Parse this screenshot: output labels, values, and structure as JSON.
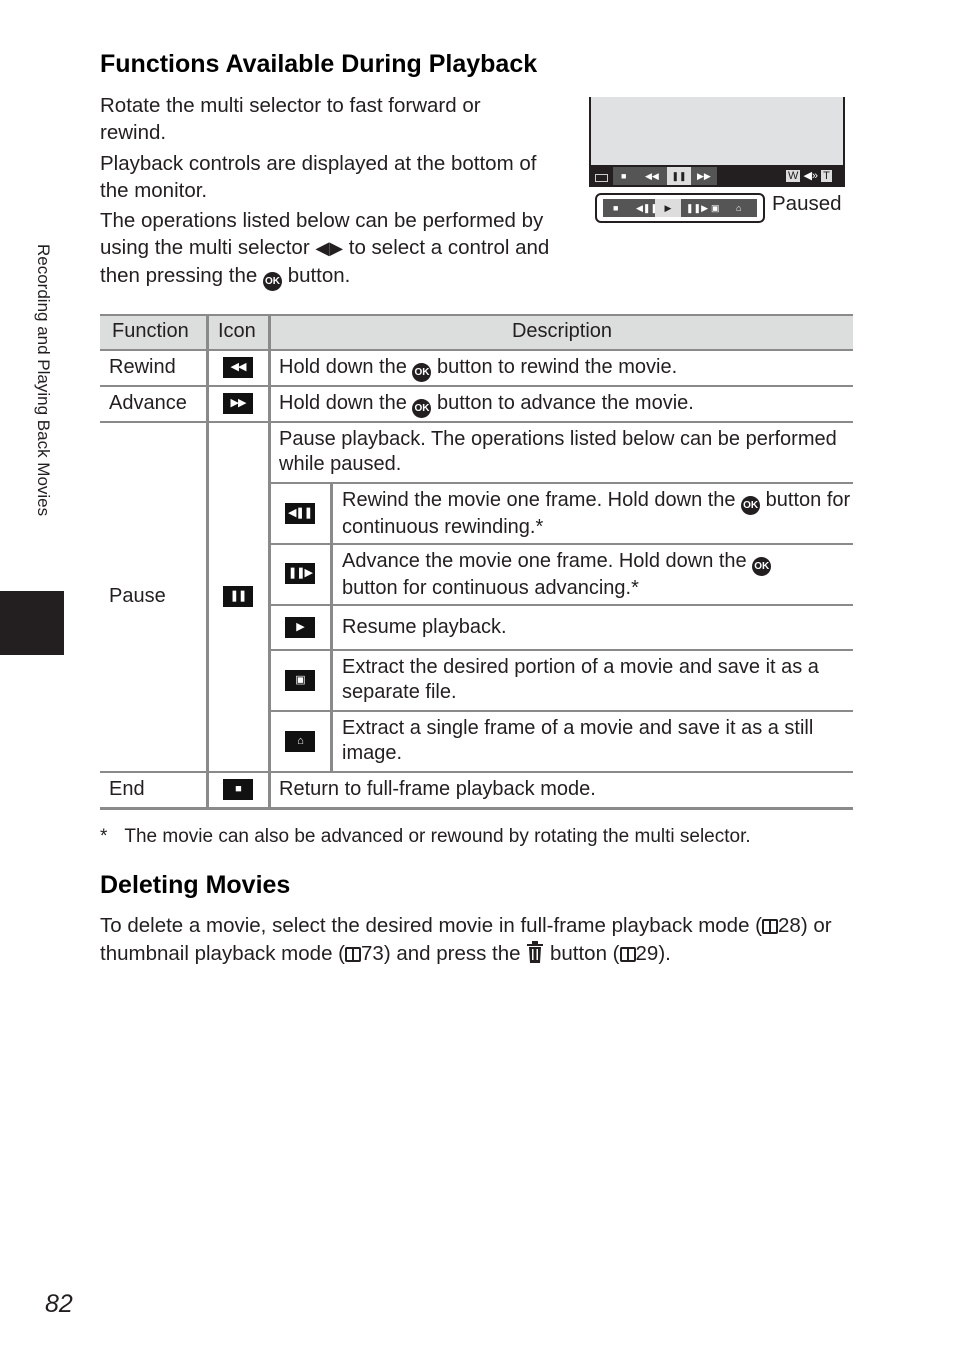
{
  "side_tab": {
    "label": "Recording and Playing Back Movies"
  },
  "section1": {
    "title": "Functions Available During Playback",
    "para1": "Rotate the multi selector to fast forward or rewind.",
    "para2": "Playback controls are displayed at the bottom of the monitor.",
    "para3_a": "The operations listed below can be performed by using the multi selector",
    "para3_b": "to select a control and then pressing the",
    "para3_c": "button.",
    "ok_label": "OK"
  },
  "illustration": {
    "status_label": "Paused",
    "zoom_w": "W",
    "zoom_t": "T"
  },
  "table": {
    "headers": {
      "function": "Function",
      "icon": "Icon",
      "description": "Description"
    },
    "rows": [
      {
        "function": "Rewind",
        "icon": "rewind-icon",
        "desc_a": "Hold down the",
        "desc_b": "button to rewind the movie."
      },
      {
        "function": "Advance",
        "icon": "advance-icon",
        "desc_a": "Hold down the",
        "desc_b": "button to advance the movie."
      },
      {
        "function": "Pause",
        "icon": "pause-icon",
        "desc": "Pause playback. The operations listed below can be performed while paused.",
        "sub": [
          {
            "icon": "frame-rewind-icon",
            "desc_a": "Rewind the movie one frame. Hold down the",
            "desc_b": "button for continuous rewinding.*"
          },
          {
            "icon": "frame-advance-icon",
            "desc_a": "Advance the movie one frame. Hold down the",
            "desc_b": "button for continuous advancing.*"
          },
          {
            "icon": "play-icon",
            "desc": "Resume playback."
          },
          {
            "icon": "movie-edit-icon",
            "desc": "Extract the desired portion of a movie and save it as a separate file."
          },
          {
            "icon": "save-frame-icon",
            "desc": "Extract a single frame of a movie and save it as a still image."
          }
        ]
      },
      {
        "function": "End",
        "icon": "stop-icon",
        "desc": "Return to full-frame playback mode."
      }
    ]
  },
  "footnote": {
    "mark": "*",
    "text": "The movie can also be advanced or rewound by rotating the multi selector."
  },
  "section2": {
    "title": "Deleting Movies",
    "text_a": "To delete a movie, select the desired movie in full-frame playback mode (",
    "ref1": "28",
    "text_b": ") or thumbnail playback mode (",
    "ref2": "73",
    "text_c": ") and press the",
    "text_d": "button (",
    "ref3": "29",
    "text_e": ")."
  },
  "page_number": "82"
}
